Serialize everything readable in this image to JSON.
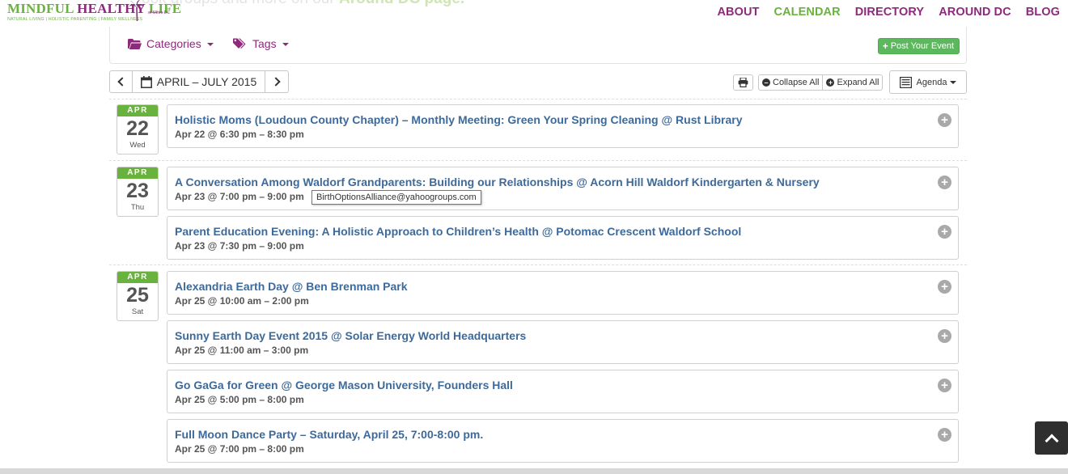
{
  "header": {
    "background_text_prefix": "ook groups and more on our ",
    "background_text_link": "Around DC page.",
    "logo": {
      "text_green_1": "MINDFUL ",
      "text_purple": "HEALTHY",
      "text_green_2": " L",
      "text_i": "I",
      "text_green_3": "FE",
      "metro": "of Metro DC",
      "tagline": "NATURAL LIVING | HOLISTIC PARENTING | FAMILY WELLNESS"
    },
    "nav": [
      {
        "label": "ABOUT",
        "active": false
      },
      {
        "label": "CALENDAR",
        "active": true
      },
      {
        "label": "DIRECTORY",
        "active": false
      },
      {
        "label": "AROUND DC",
        "active": false
      },
      {
        "label": "BLOG",
        "active": false
      }
    ]
  },
  "filters": {
    "categories_label": "Categories",
    "tags_label": "Tags",
    "post_event_label": "Post Your Event"
  },
  "toolbar": {
    "range_label": "APRIL – JULY 2015",
    "collapse_all": "Collapse All",
    "expand_all": "Expand All",
    "view_label": "Agenda"
  },
  "days": [
    {
      "month": "APR",
      "day": "22",
      "weekday": "Wed",
      "events": [
        {
          "title": "Holistic Moms (Loudoun County Chapter) – Monthly Meeting: Green Your Spring Cleaning @ Rust Library",
          "time": "Apr 22 @ 6:30 pm – 8:30 pm"
        }
      ]
    },
    {
      "month": "APR",
      "day": "23",
      "weekday": "Thu",
      "events": [
        {
          "title": "A Conversation Among Waldorf Grandparents: Building our Relationships @ Acorn Hill Waldorf Kindergarten & Nursery",
          "time": "Apr 23 @ 7:00 pm – 9:00 pm"
        },
        {
          "title": "Parent Education Evening: A Holistic Approach to Children’s Health @ Potomac Crescent Waldorf School",
          "time": "Apr 23 @ 7:30 pm – 9:00 pm"
        }
      ]
    },
    {
      "month": "APR",
      "day": "25",
      "weekday": "Sat",
      "events": [
        {
          "title": "Alexandria Earth Day @ Ben Brenman Park",
          "time": "Apr 25 @ 10:00 am – 2:00 pm"
        },
        {
          "title": "Sunny Earth Day Event 2015 @ Solar Energy World Headquarters",
          "time": "Apr 25 @ 11:00 am – 3:00 pm"
        },
        {
          "title": "Go GaGa for Green @ George Mason University, Founders Hall",
          "time": "Apr 25 @ 5:00 pm – 8:00 pm"
        },
        {
          "title": "Full Moon Dance Party – Saturday, April 25, 7:00-8:00 pm.",
          "time": "Apr 25 @ 7:00 pm – 8:00 pm"
        }
      ]
    }
  ],
  "tooltip": "BirthOptionsAlliance@yahoogroups.com",
  "colors": {
    "brand_purple": "#8e2a7b",
    "brand_green": "#6ab23e",
    "event_title": "#3d6a9a",
    "post_button": "#5cb85c"
  }
}
